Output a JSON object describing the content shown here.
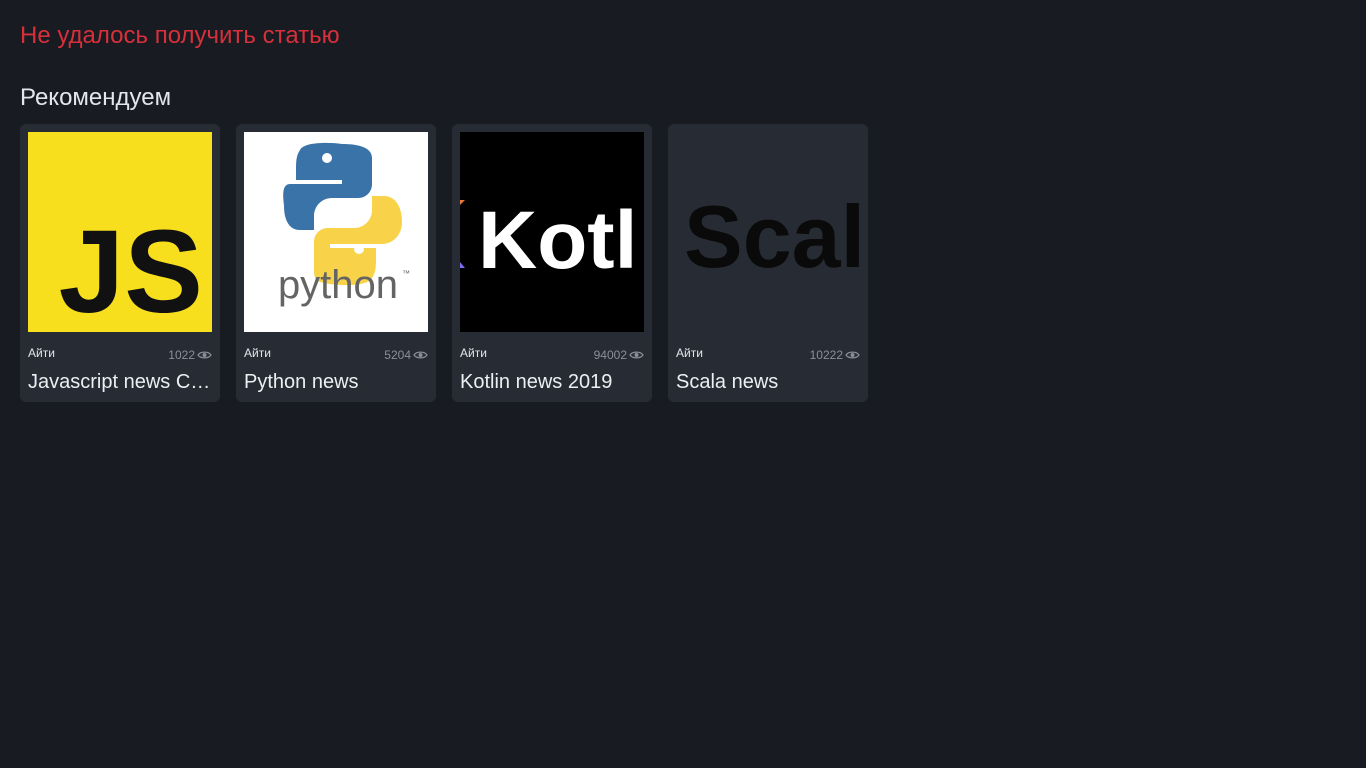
{
  "error": {
    "message": "Не удалось получить статью"
  },
  "recommend": {
    "title": "Рекомендуем",
    "cards": [
      {
        "category": "Айти",
        "views": "1022",
        "title": "Javascript news СВЕЖИЕ",
        "image": "javascript-logo",
        "logo_text": "JS"
      },
      {
        "category": "Айти",
        "views": "5204",
        "title": "Python news",
        "image": "python-logo",
        "logo_text": "python",
        "logo_tm": "™"
      },
      {
        "category": "Айти",
        "views": "94002",
        "title": "Kotlin news 2019",
        "image": "kotlin-logo",
        "logo_text": "Kotl"
      },
      {
        "category": "Айти",
        "views": "10222",
        "title": "Scala news",
        "image": "scala-logo",
        "logo_text": "Scal"
      }
    ]
  },
  "colors": {
    "background": "#181b22",
    "card": "#272c34",
    "error": "#d8303a",
    "js_yellow": "#f7df1e"
  }
}
